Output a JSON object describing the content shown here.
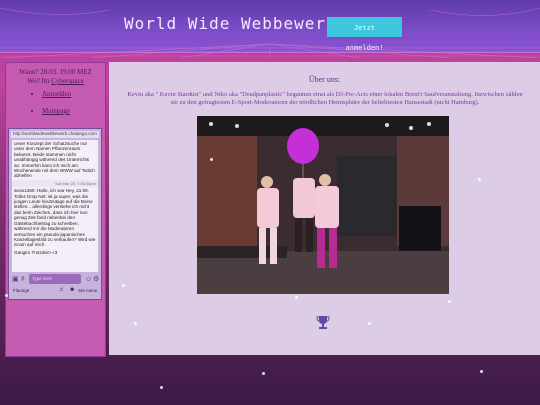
{
  "header": {
    "title": "World Wide Webbewerb",
    "login_label": "Jetzt anmelden!"
  },
  "sidebar": {
    "when_line": "Wann? 28.03. 19.00 MEZ",
    "where_prefix": "Wo? Im ",
    "where_link": "Cyberspace",
    "nav": [
      {
        "label": "Anmelden"
      },
      {
        "label": "Mainpage"
      }
    ]
  },
  "chat": {
    "url": "http://worldwidewebbewerb.chatango.com",
    "messages": [
      {
        "text": "unser Konzept der Schatzsuche nur unter dem Namen Pflanzenraum bekannt. Beide stammen nicht unabhängig während des Unterrichts an. Immerhin kann ich mich am Wochenende mit dem WWW auf Twitch abhelfen"
      },
      {
        "meta": "Sat Mar 28, 7:06:05pm"
      },
      {
        "text": "anon1360: Hallo, ich war Hey, 21:06. Tolles Drop Net: ist ja super, was die jungen Leute heutzutage auf die Beine stellen... allerdings verstehe ich nicht das beim Zeichen, dass ich hier nun genug Zeit fand nebenbei den Gästebuchbeitrag zu schreiben, während mir die Moderatoren versuchen ein pseudo-japanisches Kanzeltagesbild zu verkaufen? Wird wie Scam auf mich"
      },
      {
        "text": "Gangiro Trotzdem <3"
      }
    ],
    "input_placeholder": "Type here",
    "footer_left": "Flaunge",
    "footer_right": "Set name"
  },
  "main": {
    "title": "Über uns:",
    "text": "Kevin aka \" Kevin Stardust\" und Niko aka \"Deadpanplastic\" begannen einst als DJ-Pre-Acts einer lokalen Brent'r Saufveranstaltung. Inzwischen zählen sie zu den gefragtesten E-Sport-Moderatoren der nördlichen Hemisphäre der beliebtesten Hansestadt (nicht Hamburg)."
  },
  "colors": {
    "accent": "#3ec6dc",
    "banner": "#7b4cc7",
    "sidebar": "#c45bb0",
    "main_bg": "#dccce6",
    "title_text": "#6a2a8a"
  },
  "icons": [
    "camera-icon",
    "hash-icon",
    "emoji-icon",
    "settings-icon",
    "volume-icon",
    "person-icon",
    "trophy-logo-icon"
  ]
}
